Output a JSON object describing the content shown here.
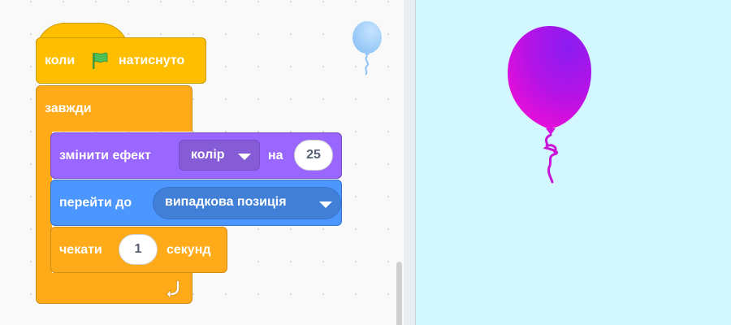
{
  "blocks": {
    "when_flag": {
      "prefix": "коли",
      "suffix": "натиснуто",
      "flag_icon": "green-flag-icon"
    },
    "forever": {
      "label": "завжди",
      "loop_icon": "loop-arrow-icon"
    },
    "change_effect": {
      "prefix": "змінити ефект",
      "effect": "колір",
      "mid": "на",
      "value": "25"
    },
    "go_to": {
      "prefix": "перейти до",
      "target": "випадкова позиція"
    },
    "wait": {
      "prefix": "чекати",
      "value": "1",
      "suffix": "секунд"
    }
  },
  "sprite": {
    "name_icon": "balloon-sprite-icon"
  },
  "stage": {
    "sprite_icon": "balloon-icon"
  },
  "colors": {
    "events": "#ffbf00",
    "control": "#ffab19",
    "looks": "#9966ff",
    "motion": "#4c97ff",
    "stage_bg": "#d3f7ff",
    "balloon": "#a31aeb"
  }
}
